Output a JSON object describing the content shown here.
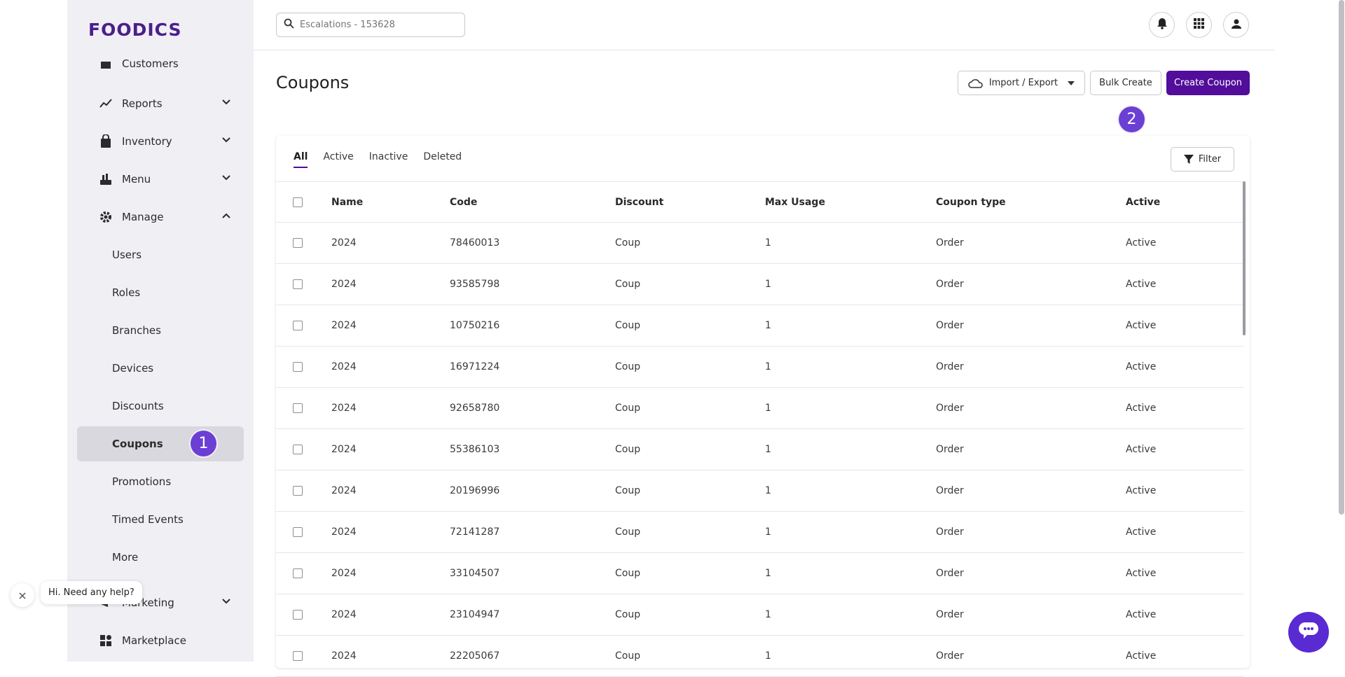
{
  "brand": {
    "logo": "FOODICS",
    "accent": "#520d9a"
  },
  "search": {
    "placeholder": "Escalations - 153628"
  },
  "sidebar": {
    "partial_item": "Customers",
    "items": [
      {
        "label": "Reports",
        "icon": "chart-line-icon",
        "expanded": false
      },
      {
        "label": "Inventory",
        "icon": "shopping-bag-icon",
        "expanded": false
      },
      {
        "label": "Menu",
        "icon": "food-icon",
        "expanded": false
      },
      {
        "label": "Manage",
        "icon": "gear-icon",
        "expanded": true
      }
    ],
    "manage_items": [
      "Users",
      "Roles",
      "Branches",
      "Devices",
      "Discounts",
      "Coupons",
      "Promotions",
      "Timed Events",
      "More"
    ],
    "selected": "Coupons",
    "bottom_items": [
      {
        "label": "Marketing",
        "icon": "megaphone-icon"
      },
      {
        "label": "Marketplace",
        "icon": "apps-icon"
      }
    ]
  },
  "step_badges": {
    "one": "1",
    "two": "2"
  },
  "page": {
    "title": "Coupons",
    "import_export": "Import / Export",
    "bulk_create": "Bulk Create",
    "create_coupon": "Create Coupon"
  },
  "tabs": [
    "All",
    "Active",
    "Inactive",
    "Deleted"
  ],
  "active_tab": "All",
  "filter_label": "Filter",
  "table": {
    "headers": {
      "name": "Name",
      "code": "Code",
      "discount": "Discount",
      "max_usage": "Max Usage",
      "coupon_type": "Coupon type",
      "active": "Active"
    },
    "rows": [
      {
        "name": "2024",
        "code": "78460013",
        "discount": "Coup",
        "max_usage": "1",
        "coupon_type": "Order",
        "active": "Active"
      },
      {
        "name": "2024",
        "code": "93585798",
        "discount": "Coup",
        "max_usage": "1",
        "coupon_type": "Order",
        "active": "Active"
      },
      {
        "name": "2024",
        "code": "10750216",
        "discount": "Coup",
        "max_usage": "1",
        "coupon_type": "Order",
        "active": "Active"
      },
      {
        "name": "2024",
        "code": "16971224",
        "discount": "Coup",
        "max_usage": "1",
        "coupon_type": "Order",
        "active": "Active"
      },
      {
        "name": "2024",
        "code": "92658780",
        "discount": "Coup",
        "max_usage": "1",
        "coupon_type": "Order",
        "active": "Active"
      },
      {
        "name": "2024",
        "code": "55386103",
        "discount": "Coup",
        "max_usage": "1",
        "coupon_type": "Order",
        "active": "Active"
      },
      {
        "name": "2024",
        "code": "20196996",
        "discount": "Coup",
        "max_usage": "1",
        "coupon_type": "Order",
        "active": "Active"
      },
      {
        "name": "2024",
        "code": "72141287",
        "discount": "Coup",
        "max_usage": "1",
        "coupon_type": "Order",
        "active": "Active"
      },
      {
        "name": "2024",
        "code": "33104507",
        "discount": "Coup",
        "max_usage": "1",
        "coupon_type": "Order",
        "active": "Active"
      },
      {
        "name": "2024",
        "code": "23104947",
        "discount": "Coup",
        "max_usage": "1",
        "coupon_type": "Order",
        "active": "Active"
      },
      {
        "name": "2024",
        "code": "22205067",
        "discount": "Coup",
        "max_usage": "1",
        "coupon_type": "Order",
        "active": "Active"
      }
    ]
  },
  "chat": {
    "greeting": "Hi. Need any help?"
  }
}
